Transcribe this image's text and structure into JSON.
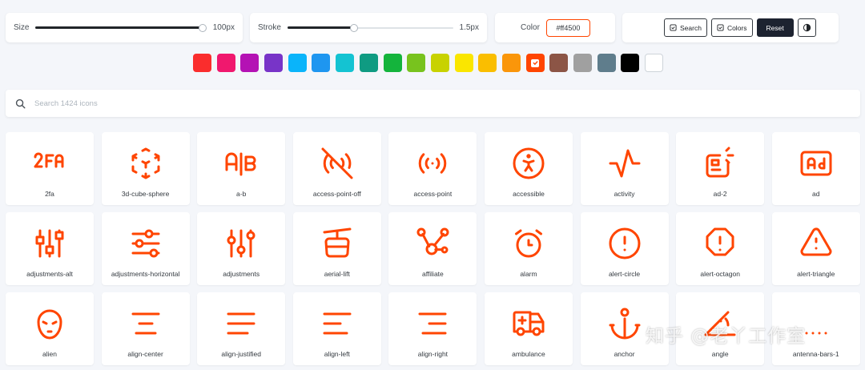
{
  "controls": {
    "size_label": "Size",
    "size_value": "100px",
    "size_level": 0.98,
    "stroke_label": "Stroke",
    "stroke_value": "1.5px",
    "stroke_level": 0.4,
    "color_label": "Color",
    "color_value": "#ff4500"
  },
  "actions": {
    "search_label": "Search",
    "colors_label": "Colors",
    "reset_label": "Reset"
  },
  "swatches": [
    "#fa2d2d",
    "#f0186e",
    "#b412b4",
    "#7834c8",
    "#0ab4fa",
    "#1e96f0",
    "#14c3d2",
    "#0f9b82",
    "#14b43c",
    "#78c31e",
    "#c8d200",
    "#fae600",
    "#fabe00",
    "#fa960a",
    "#ff4500",
    "#8c5546",
    "#a0a0a0",
    "#5f7d8c",
    "#000000",
    "#ffffff"
  ],
  "selected_swatch": "#ff4500",
  "search": {
    "placeholder": "Search 1424 icons"
  },
  "accent": "#ff4500",
  "icons": [
    {
      "name": "2fa",
      "label": "2fa"
    },
    {
      "name": "3d-cube-sphere",
      "label": "3d-cube-sphere"
    },
    {
      "name": "a-b",
      "label": "a-b"
    },
    {
      "name": "access-point-off",
      "label": "access-point-off"
    },
    {
      "name": "access-point",
      "label": "access-point"
    },
    {
      "name": "accessible",
      "label": "accessible"
    },
    {
      "name": "activity",
      "label": "activity"
    },
    {
      "name": "ad-2",
      "label": "ad-2"
    },
    {
      "name": "ad",
      "label": "ad"
    },
    {
      "name": "adjustments-alt",
      "label": "adjustments-alt"
    },
    {
      "name": "adjustments-horizontal",
      "label": "adjustments-horizontal"
    },
    {
      "name": "adjustments",
      "label": "adjustments"
    },
    {
      "name": "aerial-lift",
      "label": "aerial-lift"
    },
    {
      "name": "affiliate",
      "label": "affiliate"
    },
    {
      "name": "alarm",
      "label": "alarm"
    },
    {
      "name": "alert-circle",
      "label": "alert-circle"
    },
    {
      "name": "alert-octagon",
      "label": "alert-octagon"
    },
    {
      "name": "alert-triangle",
      "label": "alert-triangle"
    },
    {
      "name": "alien",
      "label": "alien"
    },
    {
      "name": "align-center",
      "label": "align-center"
    },
    {
      "name": "align-justified",
      "label": "align-justified"
    },
    {
      "name": "align-left",
      "label": "align-left"
    },
    {
      "name": "align-right",
      "label": "align-right"
    },
    {
      "name": "ambulance",
      "label": "ambulance"
    },
    {
      "name": "anchor",
      "label": "anchor"
    },
    {
      "name": "angle",
      "label": "angle"
    },
    {
      "name": "antenna-bars-1",
      "label": "antenna-bars-1"
    }
  ],
  "watermark": "知乎 @老丫工作室"
}
